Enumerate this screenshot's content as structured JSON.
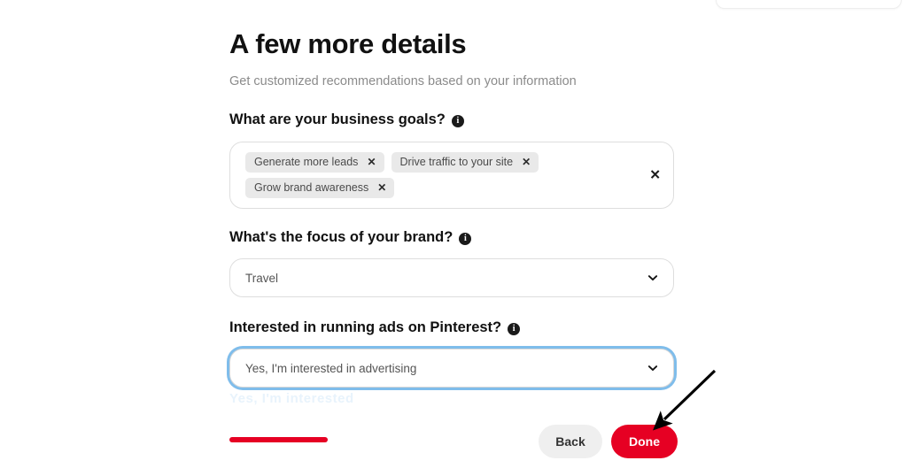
{
  "page": {
    "title": "A few more details",
    "subtitle": "Get customized recommendations based on your information",
    "ghost_artifact": "Yes, I'm interested"
  },
  "fields": {
    "business_goals": {
      "label": "What are your business goals?",
      "info_icon": "info-icon",
      "tags": [
        {
          "label": "Generate more leads",
          "remove_icon": "✕"
        },
        {
          "label": "Drive traffic to your site",
          "remove_icon": "✕"
        },
        {
          "label": "Grow brand awareness",
          "remove_icon": "✕"
        }
      ],
      "clear_all_icon": "✕"
    },
    "brand_focus": {
      "label": "What's the focus of your brand?",
      "info_icon": "info-icon",
      "value": "Travel",
      "chevron_icon": "chevron-down-icon"
    },
    "ads_interest": {
      "label": "Interested in running ads on Pinterest?",
      "info_icon": "info-icon",
      "value": "Yes, I'm interested in advertising",
      "chevron_icon": "chevron-down-icon",
      "focused": true
    }
  },
  "footer": {
    "back_label": "Back",
    "done_label": "Done",
    "progress_percent": 22
  },
  "colors": {
    "brand_red": "#e60023",
    "focus_ring_blue": "#7fbdeb",
    "tag_background": "#e9e9e9",
    "back_button": "#efefef"
  },
  "annotation": {
    "arrow_icon": "arrow-pointing-to-done-button",
    "color": "#000000"
  }
}
